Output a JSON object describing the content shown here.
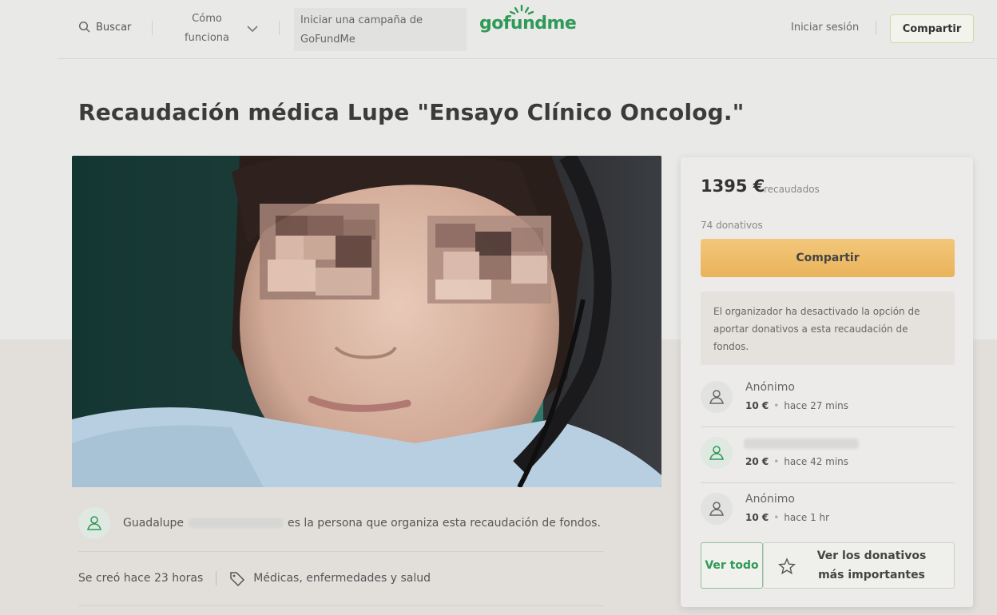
{
  "header": {
    "search_label": "Buscar",
    "how_it_works": "Cómo funciona",
    "start_campaign": "Iniciar una campaña de GoFundMe",
    "logo": "gofundme",
    "login": "Iniciar sesión",
    "share": "Compartir"
  },
  "campaign": {
    "title": "Recaudación médica Lupe \"Ensayo Clínico Oncolog.\"",
    "organizer_first_name": "Guadalupe",
    "organizer_suffix": "es la persona que organiza esta recaudación de fondos.",
    "created": "Se creó hace 23 horas",
    "category": "Médicas, enfermedades y salud"
  },
  "sidebar": {
    "amount": "1395 €",
    "raised_label": "recaudados",
    "donations_count": "74 donativos",
    "share_button": "Compartir",
    "notice": "El organizador ha desactivado la opción de aportar donativos a esta recaudación de fondos.",
    "donations": [
      {
        "name": "Anónimo",
        "amount": "10 €",
        "time": "hace 27 mins"
      },
      {
        "name": "",
        "amount": "20 €",
        "time": "hace 42 mins"
      },
      {
        "name": "Anónimo",
        "amount": "10 €",
        "time": "hace 1 hr"
      }
    ],
    "see_all": "Ver todo",
    "see_top": "Ver los donativos más importantes"
  },
  "colors": {
    "brand_green": "#2f9a58",
    "share_gold": "#eab35a"
  }
}
